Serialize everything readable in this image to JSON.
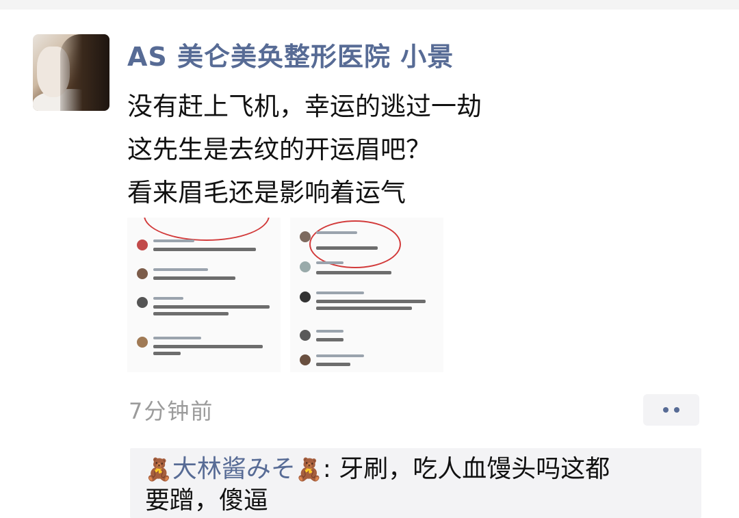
{
  "post": {
    "author": "AS 美仑美奂整形医院 小景",
    "lines": [
      "没有赶上飞机，幸运的逃过一劫",
      "这先生是去纹的开运眉吧？",
      "看来眉毛还是影响着运气"
    ],
    "time": "7分钟前"
  },
  "comment": {
    "author_emoji_left": "🧸",
    "author": "大林酱みそ",
    "author_emoji_right": "🧸",
    "separator": ": ",
    "text_line1": "牙刷，吃人血馒头吗这都",
    "text_line2": "要蹭，傻逼"
  },
  "icons": {
    "avatar": "user-avatar-photo",
    "more": "more-dots-icon"
  },
  "colors": {
    "link": "#576b95",
    "time": "#9b9b9b",
    "comment_bg": "#f3f3f5"
  }
}
